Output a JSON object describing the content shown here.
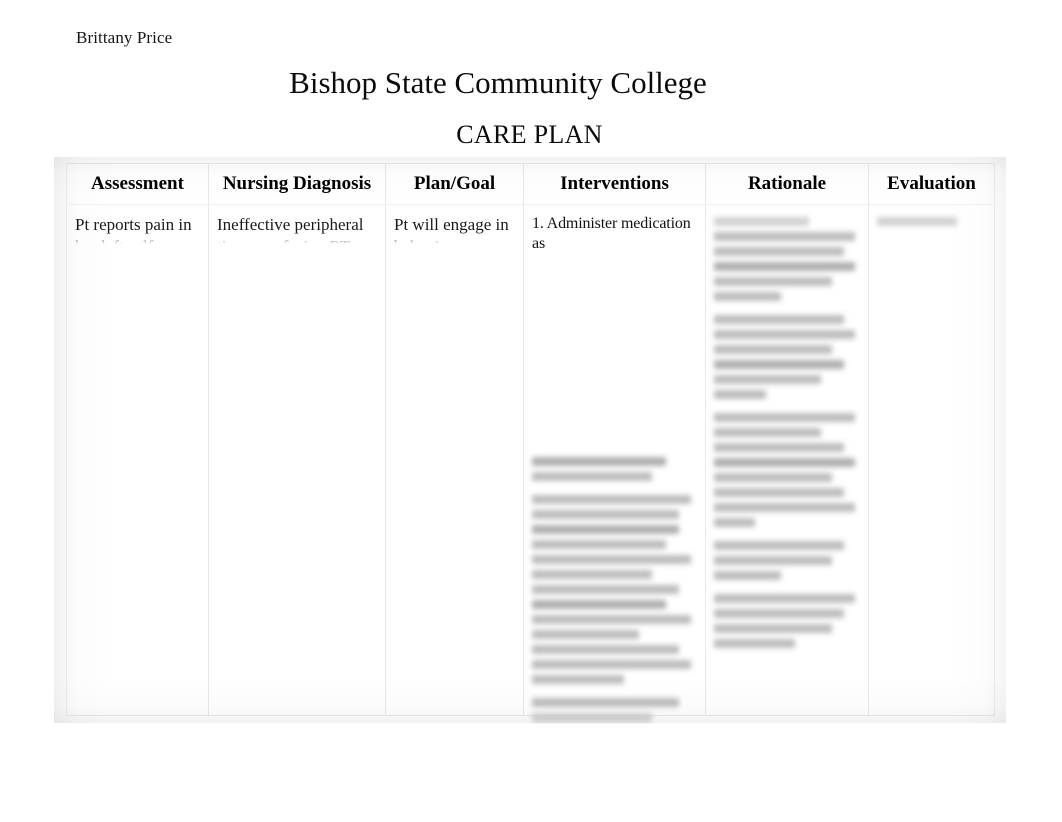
{
  "document": {
    "author": "Brittany Price",
    "institution": "Bishop State Community College",
    "title": "CARE PLAN"
  },
  "table": {
    "columns": [
      {
        "key": "assessment",
        "header": "Assessment"
      },
      {
        "key": "diagnosis",
        "header": "Nursing Diagnosis"
      },
      {
        "key": "plan_goal",
        "header": "Plan/Goal"
      },
      {
        "key": "interventions",
        "header": "Interventions"
      },
      {
        "key": "rationale",
        "header": "Rationale"
      },
      {
        "key": "evaluation",
        "header": "Evaluation"
      }
    ],
    "rows": [
      {
        "assessment": {
          "line1": "Pt reports pain in",
          "line2": "her left calf",
          "legible": true
        },
        "diagnosis": {
          "line1": "Ineffective peripheral",
          "line2": "tissue profusion RT",
          "legible": true
        },
        "plan_goal": {
          "line1": "Pt will engage in",
          "line2": "behaviors or",
          "legible": true
        },
        "interventions": {
          "line1": "1. Administer medication as",
          "line2": "",
          "legible": true,
          "remainder_illegible": true
        },
        "rationale": {
          "line1": "",
          "line2": "",
          "legible": false
        },
        "evaluation": {
          "line1": "",
          "line2": "",
          "legible": false
        }
      }
    ]
  },
  "render_notes": {
    "illegible_label": "blurred-unreadable-text",
    "page_background": "#ffffff",
    "border_color": "#e8e8e8",
    "text_color": "#000000",
    "blur_text_color": "#b9b9b9"
  }
}
